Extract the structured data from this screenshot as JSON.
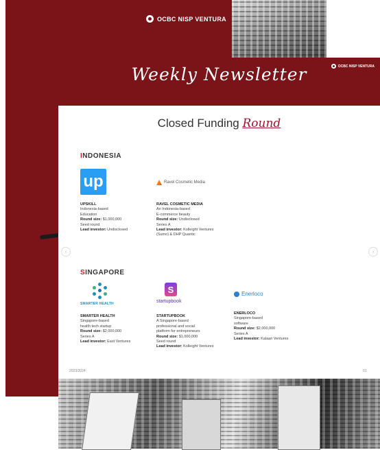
{
  "back_page": {
    "logo_text": "OCBC NISP VENTURA"
  },
  "front_page": {
    "header": {
      "title": "Weekly Newsletter",
      "logo_text": "OCBC NISP VENTURA"
    },
    "heading": {
      "main": "Closed Funding",
      "accent": "Round"
    },
    "sections": {
      "indonesia": {
        "first_letter": "I",
        "rest": "NDONESIA",
        "items": [
          {
            "logo_text": "up",
            "name": "UPSKILL",
            "lines": [
              "Indonesia-based",
              "Education"
            ],
            "round_label": "Round size:",
            "round_value": "$1,000,000",
            "stage": "Seed round",
            "lead_label": "Lead investor:",
            "lead_value": "Undisclosed"
          },
          {
            "logo_text": "Ravel Cosmetic Media",
            "name": "RAVEL COSMETIC MEDIA",
            "lines": [
              "An Indonesia-based",
              "E-commerce beauty"
            ],
            "round_label": "Round size:",
            "round_value": "Undisclosed",
            "stage": "Series A",
            "lead_label": "Lead investor:",
            "lead_value": "Kolleight Ventures",
            "extra": "(Sumo) & DHP Quantic"
          }
        ]
      },
      "singapore": {
        "first_letter": "S",
        "rest": "INGAPORE",
        "items": [
          {
            "logo_text": "SMARTER HEALTH",
            "name": "SMARTER HEALTH",
            "lines": [
              "Singapore-based",
              "health tech startup"
            ],
            "round_label": "Round size:",
            "round_value": "$2,000,000",
            "stage": "Series A",
            "lead_label": "Lead investor:",
            "lead_value": "East Ventures"
          },
          {
            "logo_text": "startupbook",
            "logo_letter": "S",
            "name": "STARTUPBOOK",
            "lines": [
              "A Singapore-based",
              "professional and social",
              "platform for entrepreneurs"
            ],
            "round_label": "Round size:",
            "round_value": "$1,000,000",
            "stage": "Seed round",
            "lead_label": "Lead investor:",
            "lead_value": "Kolleight Ventures"
          },
          {
            "logo_text": "Enerloco",
            "name": "ENERLOCO",
            "lines": [
              "Singapore-based",
              "software"
            ],
            "round_label": "Round size:",
            "round_value": "$2,000,000",
            "stage": "Series A",
            "lead_label": "Lead investor:",
            "lead_value": "Kalaari Ventures"
          }
        ]
      }
    },
    "footer": {
      "left": "2023/2024",
      "right": "01"
    },
    "arrows": {
      "prev": "‹",
      "next": "›"
    }
  }
}
